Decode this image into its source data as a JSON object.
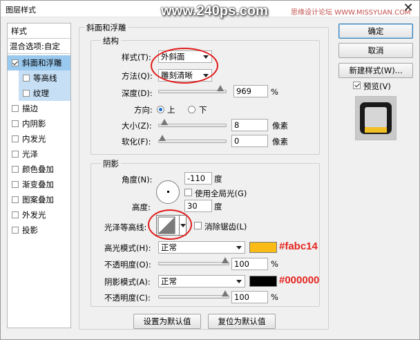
{
  "window": {
    "title": "图层样式",
    "close_glyph": "✕"
  },
  "watermark": {
    "text": "www.240ps.com",
    "site_prefix": "思缘设计论坛 ",
    "site_url": "WWW.MISSYUAN.COM"
  },
  "left_panel": {
    "header": "样式",
    "blend_options": "混合选项:自定",
    "items": [
      {
        "label": "斜面和浮雕",
        "checked": true
      },
      {
        "label": "等高线",
        "checked": false
      },
      {
        "label": "纹理",
        "checked": false
      },
      {
        "label": "描边",
        "checked": false
      },
      {
        "label": "内阴影",
        "checked": false
      },
      {
        "label": "内发光",
        "checked": false
      },
      {
        "label": "光泽",
        "checked": false
      },
      {
        "label": "颜色叠加",
        "checked": false
      },
      {
        "label": "渐变叠加",
        "checked": false
      },
      {
        "label": "图案叠加",
        "checked": false
      },
      {
        "label": "外发光",
        "checked": false
      },
      {
        "label": "投影",
        "checked": false
      }
    ]
  },
  "bevel": {
    "group_title": "斜面和浮雕",
    "structure": {
      "title": "结构",
      "style_label": "样式(T):",
      "style_value": "外斜面",
      "technique_label": "方法(Q):",
      "technique_value": "雕刻清晰",
      "depth_label": "深度(D):",
      "depth_value": "969",
      "depth_unit": "%",
      "depth_fraction": 0.97,
      "direction_label": "方向:",
      "direction_up": "上",
      "direction_down": "下",
      "size_label": "大小(Z):",
      "size_value": "8",
      "size_unit": "像素",
      "size_fraction": 0.03,
      "soften_label": "软化(F):",
      "soften_value": "0",
      "soften_unit": "像素",
      "soften_fraction": 0.0
    },
    "shading": {
      "title": "阴影",
      "angle_label": "角度(N):",
      "angle_value": "-110",
      "angle_unit": "度",
      "global_light_label": "使用全局光(G)",
      "altitude_label": "高度:",
      "altitude_value": "30",
      "altitude_unit": "度",
      "gloss_contour_label": "光泽等高线:",
      "anti_alias_label": "消除锯齿(L)",
      "highlight_mode_label": "高光模式(H):",
      "highlight_mode_value": "正常",
      "highlight_color": "#fabc14",
      "highlight_hex_label": "#fabc14",
      "highlight_opacity_label": "不透明度(O):",
      "highlight_opacity_value": "100",
      "highlight_opacity_unit": "%",
      "shadow_mode_label": "阴影模式(A):",
      "shadow_mode_value": "正常",
      "shadow_color": "#000000",
      "shadow_hex_label": "#000000",
      "shadow_opacity_label": "不透明度(C):",
      "shadow_opacity_value": "100",
      "shadow_opacity_unit": "%"
    },
    "make_default_button": "设置为默认值",
    "reset_default_button": "复位为默认值"
  },
  "actions": {
    "ok": "确定",
    "cancel": "取消",
    "new_style": "新建样式(W)...",
    "preview_label": "预览(V)"
  },
  "colors": {
    "accent": "#99c9ef",
    "annotation": "#e21a1a",
    "preview_yellow": "#f0c026"
  }
}
